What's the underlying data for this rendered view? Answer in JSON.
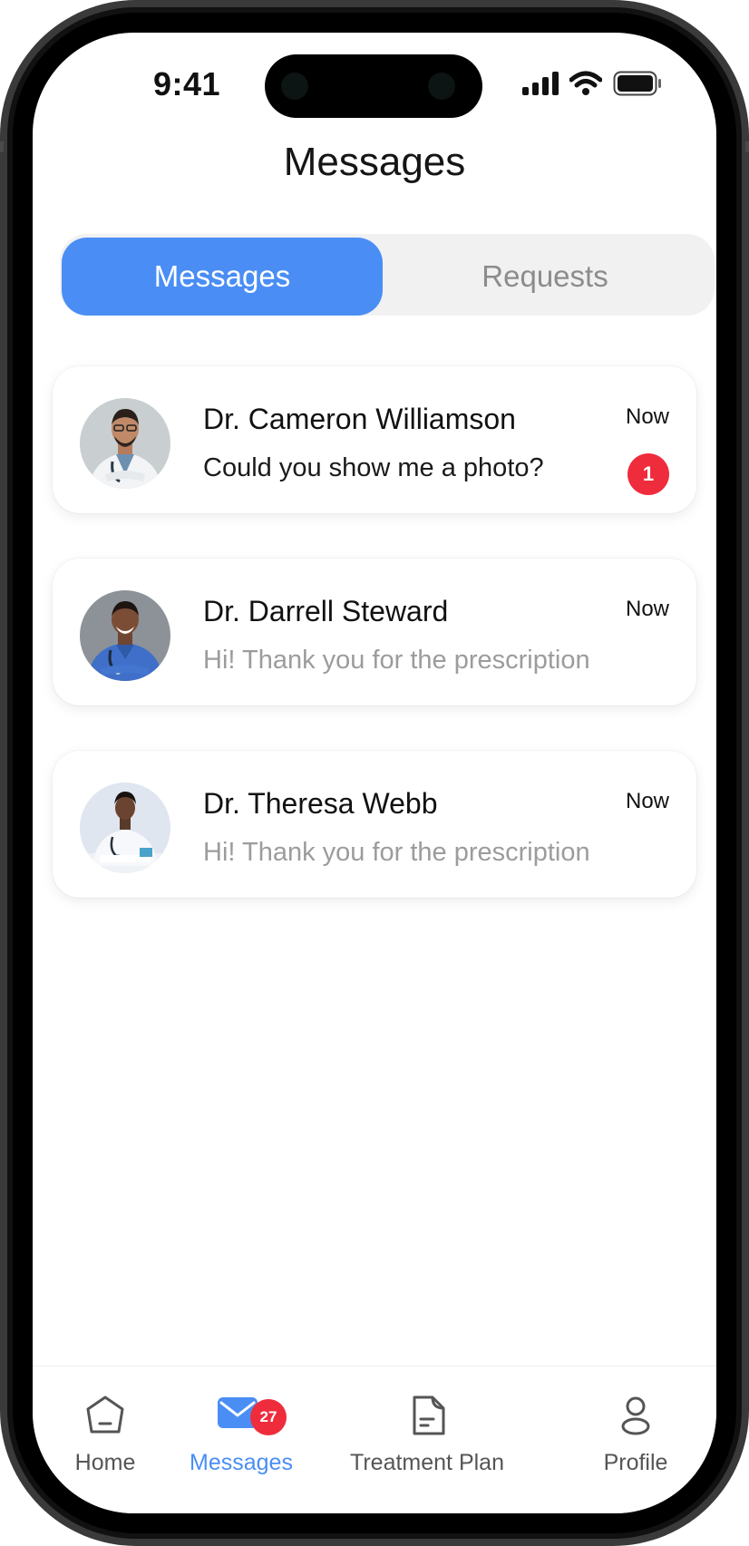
{
  "status_bar": {
    "time": "9:41"
  },
  "header": {
    "title": "Messages"
  },
  "tabs": [
    {
      "label": "Messages",
      "active": true
    },
    {
      "label": "Requests",
      "active": false
    }
  ],
  "conversations": [
    {
      "name": "Dr. Cameron Williamson",
      "time": "Now",
      "preview": "Could you show me a photo?",
      "unread_count": "1"
    },
    {
      "name": "Dr. Darrell Steward",
      "time": "Now",
      "preview": "Hi! Thank you for the prescription",
      "unread_count": ""
    },
    {
      "name": "Dr. Theresa Webb",
      "time": "Now",
      "preview": "Hi! Thank you for the prescription",
      "unread_count": ""
    }
  ],
  "bottom_nav": {
    "items": [
      {
        "label": "Home",
        "icon": "home-icon",
        "active": false
      },
      {
        "label": "Messages",
        "icon": "envelope-icon",
        "active": true,
        "badge": "27"
      },
      {
        "label": "Treatment Plan",
        "icon": "document-icon",
        "active": false
      },
      {
        "label": "Profile",
        "icon": "person-icon",
        "active": false
      }
    ]
  },
  "colors": {
    "accent": "#4a8ef5",
    "badge": "#ef2c3c",
    "muted_text": "#9c9c9c",
    "segment_bg": "#f1f1f1"
  }
}
